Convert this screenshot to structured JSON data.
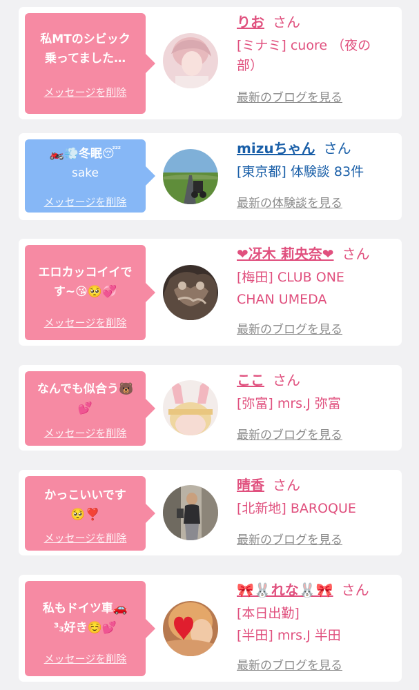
{
  "delete_label": "メッセージを削除",
  "cards": [
    {
      "message_lines": [
        "私MTのシビック",
        "乗ってました…"
      ],
      "name": "りお",
      "honorific": "さん",
      "details": [
        "[ミナミ] cuore （夜の",
        "部）"
      ],
      "link": "最新のブログを見る"
    },
    {
      "message_lines": [
        "🏍️💨冬眠😴",
        "sake"
      ],
      "name": "mizuちゃん",
      "honorific": "さん",
      "details": [
        "[東京都] 体験談 83件"
      ],
      "link": "最新の体験談を見る"
    },
    {
      "message_lines": [
        "エロカッコイイで",
        "す~😘🥺💞"
      ],
      "name": "❤冴木 莉央奈❤",
      "honorific": "さん",
      "details": [
        "[梅田] CLUB ONE",
        "CHAN UMEDA"
      ],
      "link": "最新のブログを見る"
    },
    {
      "message_lines": [
        "なんでも似合う🐻",
        "💕"
      ],
      "name": "ここ",
      "honorific": "さん",
      "details": [
        "[弥富] mrs.J 弥富"
      ],
      "link": "最新のブログを見る"
    },
    {
      "message_lines": [
        "かっこいいです",
        "🥺❣️"
      ],
      "name": "晴香",
      "honorific": "さん",
      "details": [
        "[北新地] BAROQUE"
      ],
      "link": "最新のブログを見る"
    },
    {
      "message_lines": [
        "私もドイツ車🚗",
        "³₃好き☺️💕"
      ],
      "name": "🎀🐰れな🐰🎀",
      "honorific": "さん",
      "details": [
        "本日出勤",
        "[半田] mrs.J 半田"
      ],
      "link": "最新のブログを見る"
    }
  ],
  "colors": {
    "page_bg": "#f1f1f3",
    "bubble_pink": "#f68aa3",
    "bubble_blue": "#86b7f6",
    "name_pink": "#e0507e",
    "name_blue": "#1a5fa8",
    "link_gray": "#8a8a8a"
  }
}
